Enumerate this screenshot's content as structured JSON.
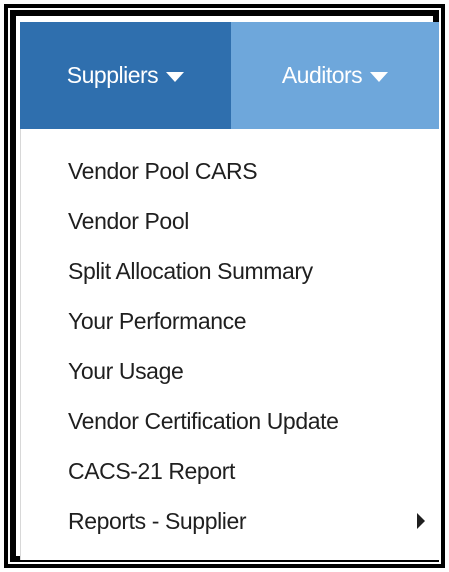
{
  "nav": {
    "tabs": [
      {
        "label": "Suppliers",
        "icon": "caret-down-icon"
      },
      {
        "label": "Auditors",
        "icon": "caret-down-icon"
      }
    ],
    "colors": {
      "active_tab": "#2f6fae",
      "inactive_tab": "#6ea7db"
    }
  },
  "menu": {
    "items": [
      {
        "label": "Vendor Pool CARS"
      },
      {
        "label": "Vendor Pool"
      },
      {
        "label": "Split Allocation Summary"
      },
      {
        "label": "Your Performance"
      },
      {
        "label": "Your Usage"
      },
      {
        "label": "Vendor Certification Update"
      },
      {
        "label": "CACS-21 Report"
      },
      {
        "label": "Reports - Supplier",
        "icon": "caret-right-icon"
      }
    ]
  }
}
